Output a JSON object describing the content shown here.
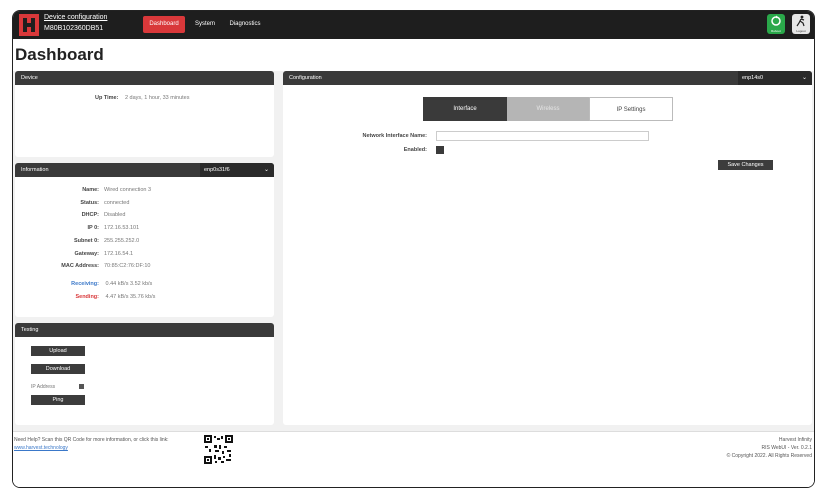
{
  "header": {
    "device_title": "Device configuration",
    "serial": "M80B102360DB51",
    "nav": [
      "Dashboard",
      "System",
      "Diagnostics"
    ],
    "reboot_label": "Reboot",
    "logout_label": "Logout",
    "accent": "#d9383a"
  },
  "page_title": "Dashboard",
  "device_panel": {
    "title": "Device",
    "uptime_label": "Up Time:",
    "uptime_value": "2 days, 1 hour, 33 minutes"
  },
  "information_panel": {
    "title": "Information",
    "selected_interface": "enp0s31f6",
    "rows": [
      {
        "label": "Name:",
        "value": "Wired connection 3"
      },
      {
        "label": "Status:",
        "value": "connected"
      },
      {
        "label": "DHCP:",
        "value": "Disabled"
      },
      {
        "label": "IP 0:",
        "value": "172.16.53.101"
      },
      {
        "label": "Subnet 0:",
        "value": "255.255.252.0"
      },
      {
        "label": "Gateway:",
        "value": "172.16.54.1"
      },
      {
        "label": "MAC Address:",
        "value": "70:85:C2:76:DF:10"
      }
    ],
    "receiving_label": "Receiving:",
    "receiving_value": "0.44 kB/s 3.52 kb/s",
    "sending_label": "Sending:",
    "sending_value": "4.47 kB/s 35.76 kb/s"
  },
  "testing_panel": {
    "title": "Testing",
    "upload_label": "Upload",
    "download_label": "Download",
    "ip_placeholder": "IP Address",
    "ping_label": "Ping"
  },
  "configuration_panel": {
    "title": "Configuration",
    "selected_interface": "enp14s0",
    "tabs": [
      "Interface",
      "Wireless",
      "IP Settings"
    ],
    "network_interface_label": "Network Interface Name:",
    "network_interface_value": "",
    "enabled_label": "Enabled:",
    "save_label": "Save Changes"
  },
  "footer": {
    "help_text": "Need Help? Scan this QR Code for more information, or click this link:",
    "link_text": "www.harvest.technology",
    "company": "Harvest Infinity",
    "version": "RIS WebUI - Ver. 0.2.1",
    "copyright": "© Copyright 2022. All Rights Reserved"
  }
}
